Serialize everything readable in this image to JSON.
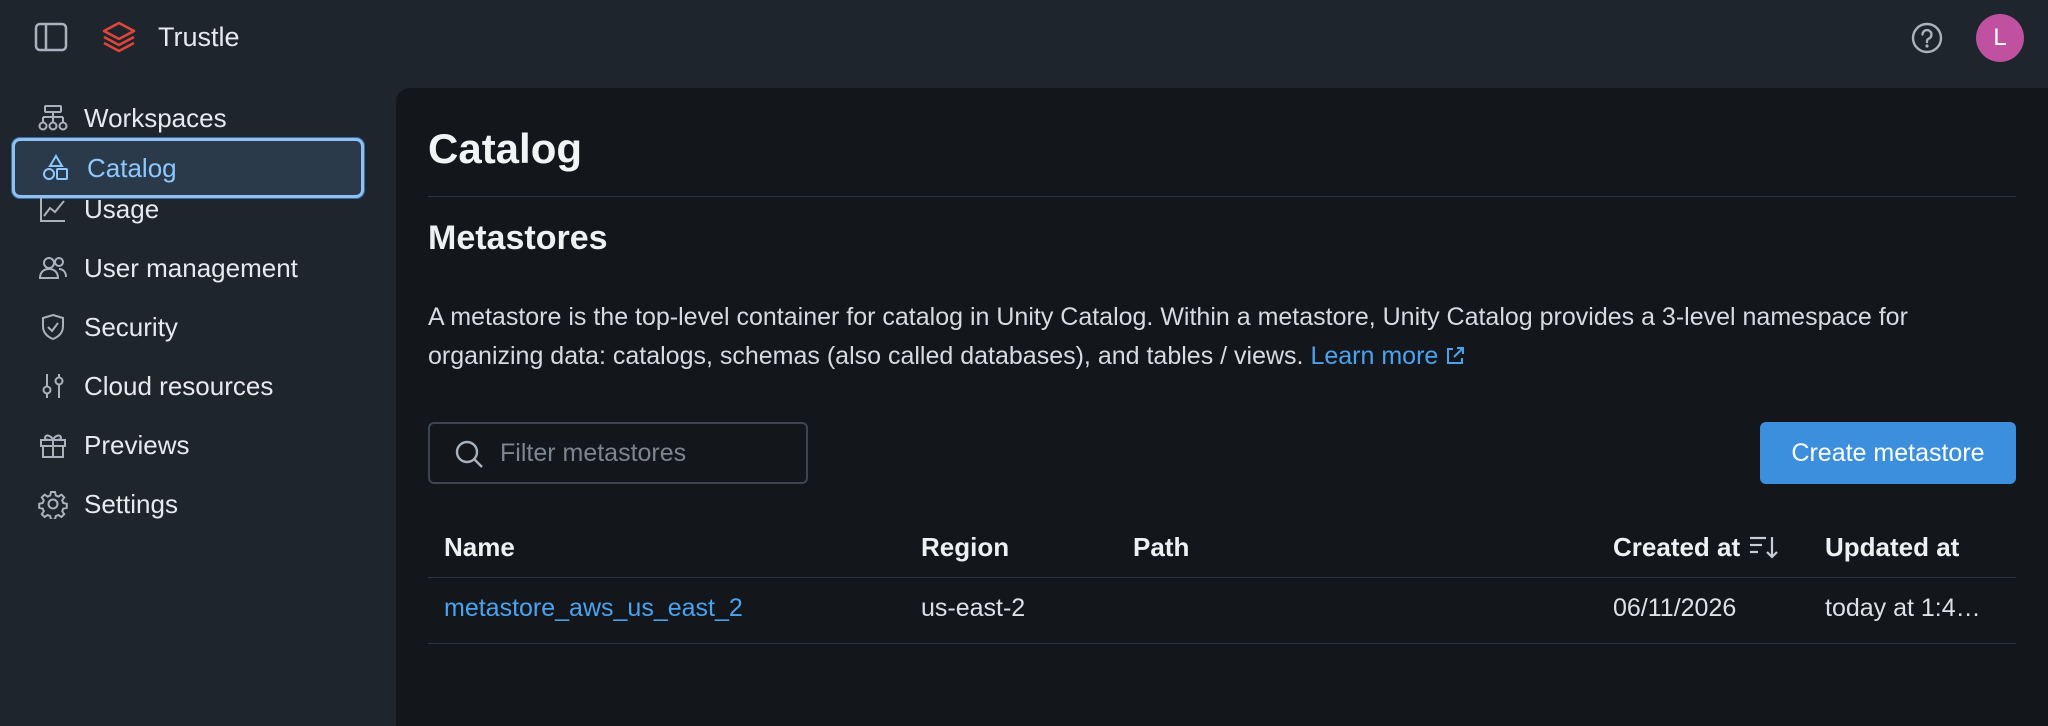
{
  "app": {
    "name": "Trustle",
    "avatar_initial": "L"
  },
  "icons": {
    "sidebar_toggle": "sidebar-toggle-icon",
    "logo": "layers-logo",
    "help": "question-circle-icon",
    "search": "search-icon",
    "external": "external-link-icon",
    "sort": "sort-descending-icon"
  },
  "colors": {
    "accent": "#3b8fdd",
    "link": "#4aa3f0",
    "logo": "#e0453a",
    "avatar": "#c050a0"
  },
  "sidebar": {
    "items": [
      {
        "label": "Workspaces",
        "icon": "workspaces-icon",
        "active": false
      },
      {
        "label": "Catalog",
        "icon": "catalog-icon",
        "active": true
      },
      {
        "label": "Usage",
        "icon": "chart-line-icon",
        "active": false
      },
      {
        "label": "User management",
        "icon": "users-icon",
        "active": false
      },
      {
        "label": "Security",
        "icon": "shield-icon",
        "active": false
      },
      {
        "label": "Cloud resources",
        "icon": "sliders-icon",
        "active": false
      },
      {
        "label": "Previews",
        "icon": "gift-icon",
        "active": false
      },
      {
        "label": "Settings",
        "icon": "gear-icon",
        "active": false
      }
    ]
  },
  "main": {
    "title": "Catalog",
    "section_title": "Metastores",
    "description": "A metastore is the top-level container for catalog in Unity Catalog. Within a metastore, Unity Catalog provides a 3-level namespace for organizing data: catalogs, schemas (also called databases), and tables / views.",
    "learn_more": "Learn more",
    "filter": {
      "placeholder": "Filter metastores",
      "value": ""
    },
    "create_button": "Create metastore",
    "table": {
      "columns": [
        "Name",
        "Region",
        "Path",
        "Created at",
        "Updated at"
      ],
      "rows": [
        {
          "name": "metastore_aws_us_east_2",
          "region": "us-east-2",
          "path": "",
          "created_at": "06/11/2026",
          "updated_at": "today at 1:4…"
        }
      ]
    }
  }
}
